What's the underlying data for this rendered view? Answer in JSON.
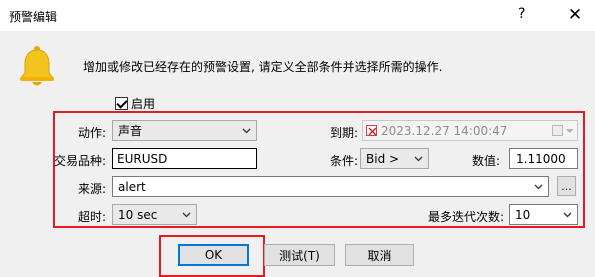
{
  "window": {
    "title": "预警编辑",
    "help_label": "?",
    "close_label": "✕"
  },
  "description": "增加或修改已经存在的预警设置, 请定义全部条件并选择所需的操作.",
  "enable": {
    "label": "启用",
    "checked": true
  },
  "action": {
    "label": "动作:",
    "value": "声音"
  },
  "expiry": {
    "label": "到期:",
    "value": "2023.12.27 14:00:47",
    "enabled": false
  },
  "symbol": {
    "label": "交易品种:",
    "value": "EURUSD"
  },
  "condition": {
    "label": "条件:",
    "value": "Bid >"
  },
  "amount": {
    "label": "数值:",
    "value": "1.11000"
  },
  "source": {
    "label": "来源:",
    "value": "alert",
    "browse_label": "..."
  },
  "timeout": {
    "label": "超时:",
    "value": "10 sec"
  },
  "max_iterations": {
    "label": "最多迭代次数:",
    "value": "10"
  },
  "buttons": {
    "ok": "OK",
    "test": "测试(T)",
    "cancel": "取消"
  },
  "colors": {
    "highlight": "#e31c24",
    "bell": "#f5c320",
    "default_button_border": "#0078d7"
  },
  "icons": {
    "bell": "bell-icon",
    "checkbox": "checkbox-checked-icon",
    "dropdown": "chevron-down-icon",
    "date_unchecked": "red-x-icon"
  }
}
